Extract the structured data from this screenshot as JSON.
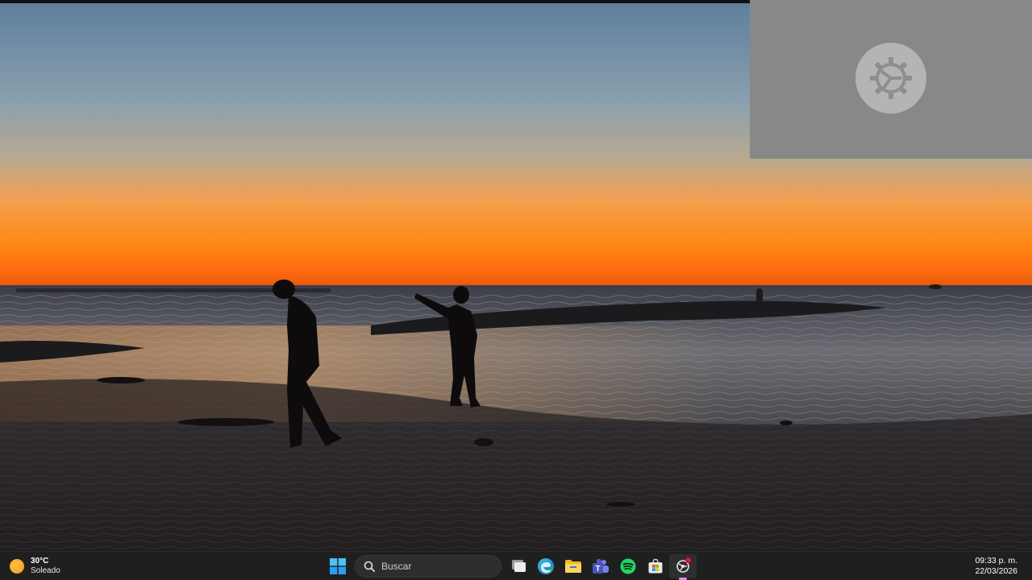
{
  "desktop": {
    "wallpaper_description_icon": "beach-sunset-wallpaper"
  },
  "settings_window": {
    "icon": "gear-icon"
  },
  "taskbar": {
    "weather": {
      "temperature": "30°C",
      "condition": "Soleado",
      "icon": "sun-icon"
    },
    "start": {
      "icon": "windows-logo-icon"
    },
    "search": {
      "placeholder": "Buscar",
      "icon": "search-icon"
    },
    "pinned_apps": [
      {
        "name": "Task View",
        "icon": "task-view-icon"
      },
      {
        "name": "Microsoft Edge",
        "icon": "edge-icon"
      },
      {
        "name": "File Explorer",
        "icon": "folder-icon"
      },
      {
        "name": "Microsoft Teams",
        "icon": "teams-icon"
      },
      {
        "name": "Spotify",
        "icon": "spotify-icon"
      },
      {
        "name": "Microsoft Store",
        "icon": "store-icon"
      },
      {
        "name": "Settings",
        "icon": "settings-icon",
        "active": true
      }
    ],
    "clock": {
      "time": "09:33 p. m.",
      "date": "22/03/2026"
    }
  },
  "colors": {
    "taskbar_bg": "#1f1f1f",
    "settings_bg": "#888888",
    "active_indicator": "#e28be3",
    "notification": "#e81123"
  }
}
